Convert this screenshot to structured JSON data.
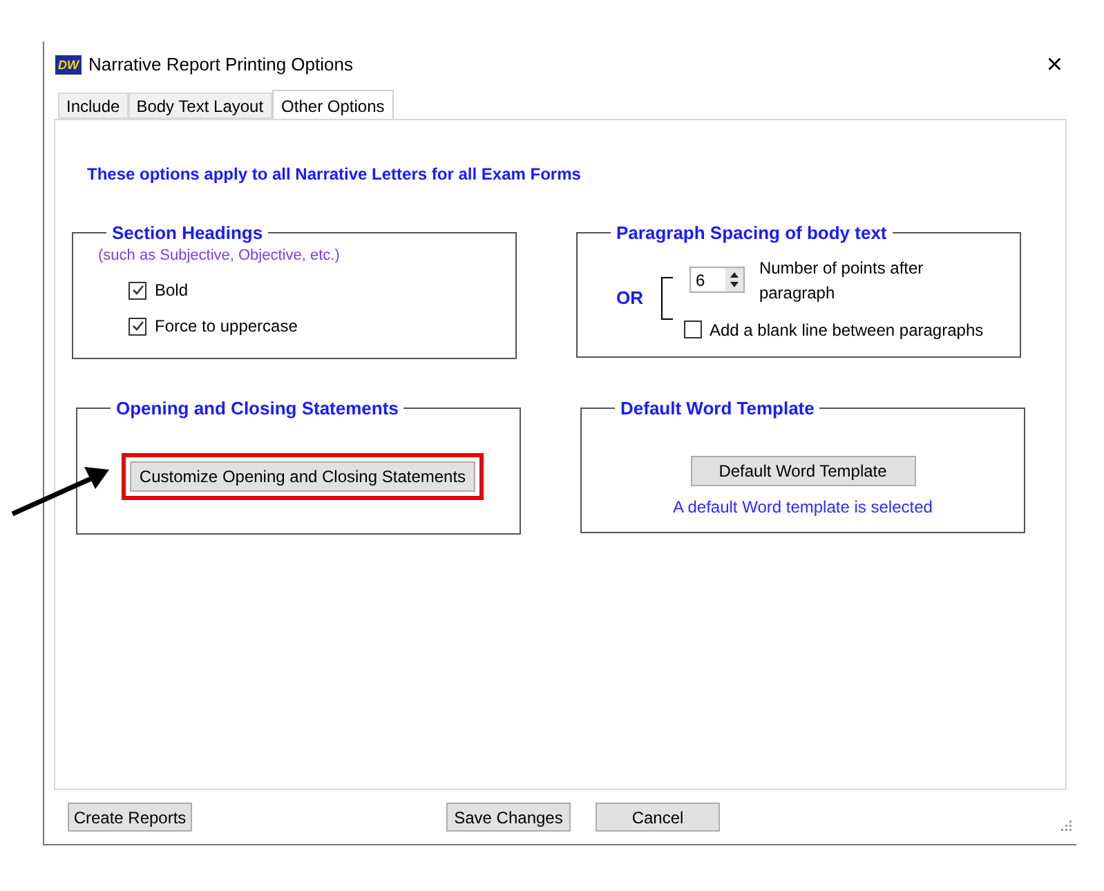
{
  "window": {
    "title": "Narrative Report Printing Options",
    "logo": "DW",
    "close": "×"
  },
  "tabs": [
    {
      "label": "Include",
      "selected": false
    },
    {
      "label": "Body Text Layout",
      "selected": false
    },
    {
      "label": "Other Options",
      "selected": true
    }
  ],
  "intro": "These options apply to all Narrative Letters for all Exam Forms",
  "section_headings": {
    "title": "Section Headings",
    "note": "(such as Subjective, Objective, etc.)",
    "options": [
      {
        "label": "Bold",
        "checked": true
      },
      {
        "label": "Force to uppercase",
        "checked": true
      }
    ]
  },
  "paragraph_spacing": {
    "title": "Paragraph Spacing of body text",
    "or": "OR",
    "points": {
      "value": "6",
      "label": "Number of points after paragraph"
    },
    "blank_line": {
      "label": "Add a blank line between paragraphs",
      "checked": false
    }
  },
  "opening_closing": {
    "title": "Opening and Closing Statements",
    "button": "Customize Opening and Closing Statements",
    "highlighted": true
  },
  "word_template": {
    "title": "Default Word Template",
    "button": "Default Word Template",
    "status": "A default Word template is selected"
  },
  "footer_buttons": [
    "Create Reports",
    "Save Changes",
    "Cancel"
  ]
}
